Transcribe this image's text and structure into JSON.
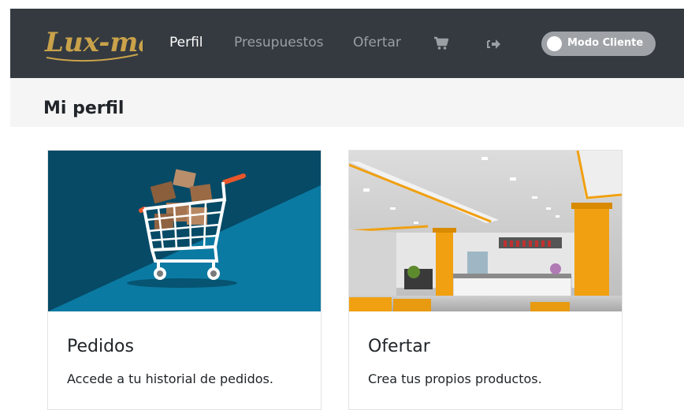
{
  "brand": {
    "logo_text": "Lux-may",
    "logo_color": "#c9a24a"
  },
  "navbar": {
    "background": "#343a40",
    "links": [
      {
        "label": "Perfil",
        "active": true
      },
      {
        "label": "Presupuestos",
        "active": false
      },
      {
        "label": "Ofertar",
        "active": false
      }
    ],
    "icons": [
      "cart-icon",
      "logout-icon"
    ],
    "toggle": {
      "label": "Modo Cliente",
      "on": false
    }
  },
  "page": {
    "title": "Mi perfil"
  },
  "cards": [
    {
      "title": "Pedidos",
      "text": "Accede a tu historial de pedidos.",
      "image": "shopping-cart-illustration"
    },
    {
      "title": "Ofertar",
      "text": "Crea tus propios productos.",
      "image": "store-interior-photo"
    }
  ],
  "colors": {
    "accent_orange": "#f0a010",
    "card_blue": "#0b6f94",
    "card_dark_blue": "#064a66"
  }
}
